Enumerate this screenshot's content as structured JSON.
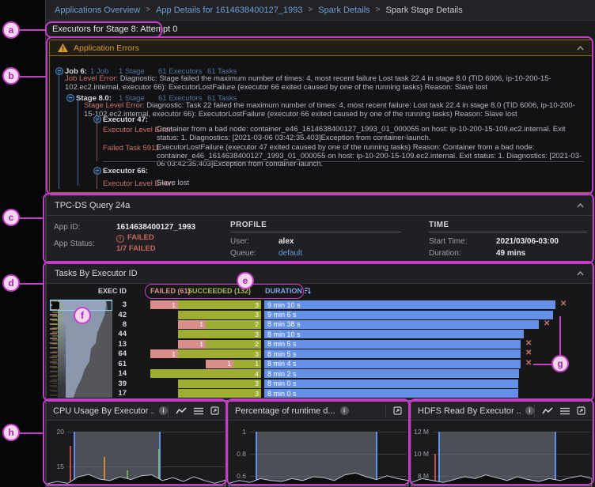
{
  "breadcrumb": {
    "separator": ">",
    "items": [
      {
        "label": "Applications Overview",
        "current": false
      },
      {
        "label": "App Details for 1614638400127_1993",
        "current": false
      },
      {
        "label": "Spark Details",
        "current": false
      },
      {
        "label": "Spark Stage Details",
        "current": true
      }
    ]
  },
  "page_title": "Executors for Stage 8: Attempt 0",
  "errors_panel": {
    "title": "Application Errors",
    "job_label": "Job 6:",
    "job_counts": [
      "1 Job",
      "1 Stage",
      "61 Executors",
      "61 Tasks"
    ],
    "job_error_label": "Job Level Error:",
    "job_error_text": "Diagnostic: Stage failed the maximum number of times: 4, most recent failure Lost task 22.4 in stage 8.0 (TID 6006, ip-10-200-15-102.ec2.internal, executor 66): ExecutorLostFailure (executor 66 exited caused by one of the running tasks) Reason: Slave lost",
    "stage_label": "Stage 8.0:",
    "stage_counts": [
      "1 Stage",
      "61 Executors",
      "61 Tasks"
    ],
    "stage_error_label": "Stage Level Error:",
    "stage_error_text": "Diagnostic: Task 22 failed the maximum number of times: 4, most recent failure: Lost task 22.4 in stage 8.0 (TID 6006, ip-10-200-15-102.ec2.internal, executor 66): ExecutorLostFailure (executor 66 exited caused by one of the running tasks) Reason: Slave lost",
    "executors": [
      {
        "label": "Executor 47:",
        "rows": [
          {
            "label": "Executor Level Error:",
            "text": "Container from a bad node: container_e46_1614638400127_1993_01_000055 on host: ip-10-200-15-109.ec2.internal. Exit status: 1. Diagnostics: [2021-03-06 03:42:35.403]Exception from container-launch."
          },
          {
            "label": "Failed Task 5911:",
            "text": "ExecutorLostFailure (executor 47 exited caused by one of the running tasks) Reason: Container from a bad node: container_e46_1614638400127_1993_01_000055 on host: ip-10-200-15-109.ec2.internal. Exit status: 1. Diagnostics: [2021-03-06 03:42:35.403]Exception from container-launch."
          }
        ]
      },
      {
        "label": "Executor 66:",
        "rows": [
          {
            "label": "Executor Level Error:",
            "text": "Slave lost"
          }
        ]
      }
    ]
  },
  "query_panel": {
    "title": "TPC-DS Query 24a",
    "app_id_label": "App ID:",
    "app_id": "1614638400127_1993",
    "app_status_label": "App Status:",
    "status_failed": "FAILED",
    "status_ratio": "1/7 FAILED",
    "profile_header": "PROFILE",
    "user_label": "User:",
    "user": "alex",
    "queue_label": "Queue:",
    "queue": "default",
    "time_header": "TIME",
    "start_label": "Start Time:",
    "start": "2021/03/06-03:00",
    "duration_label": "Duration:",
    "duration": "49 mins"
  },
  "tasks_panel": {
    "title": "Tasks By Executor ID",
    "col_exec": "EXEC ID",
    "col_failed": "FAILED (61)",
    "col_succeeded": "SUCCEEDED (132)",
    "col_duration": "DURATION",
    "rows": [
      {
        "exec_id": "3",
        "failed": 1,
        "succeeded": 3,
        "duration": "9 min 10 s",
        "duration_s": 550,
        "lost": true
      },
      {
        "exec_id": "42",
        "failed": 0,
        "succeeded": 3,
        "duration": "9 min 6 s",
        "duration_s": 546,
        "lost": false
      },
      {
        "exec_id": "8",
        "failed": 1,
        "succeeded": 2,
        "duration": "8 min 38 s",
        "duration_s": 518,
        "lost": true
      },
      {
        "exec_id": "44",
        "failed": 0,
        "succeeded": 3,
        "duration": "8 min 10 s",
        "duration_s": 490,
        "lost": false
      },
      {
        "exec_id": "13",
        "failed": 1,
        "succeeded": 2,
        "duration": "8 min 5 s",
        "duration_s": 485,
        "lost": true
      },
      {
        "exec_id": "64",
        "failed": 1,
        "succeeded": 3,
        "duration": "8 min 5 s",
        "duration_s": 485,
        "lost": true
      },
      {
        "exec_id": "61",
        "failed": 1,
        "succeeded": 1,
        "duration": "8 min 4 s",
        "duration_s": 484,
        "lost": true
      },
      {
        "exec_id": "14",
        "failed": 0,
        "succeeded": 4,
        "duration": "8 min 2 s",
        "duration_s": 482,
        "lost": false
      },
      {
        "exec_id": "39",
        "failed": 0,
        "succeeded": 3,
        "duration": "8 min 0 s",
        "duration_s": 480,
        "lost": false
      },
      {
        "exec_id": "17",
        "failed": 0,
        "succeeded": 3,
        "duration": "8 min 0 s",
        "duration_s": 480,
        "lost": false
      }
    ]
  },
  "charts": [
    {
      "title": "CPU Usage By Executor ...",
      "y_ticks": [
        "20",
        "15"
      ],
      "tick_gap": 44,
      "icons": [
        "line-chart",
        "list",
        "expand"
      ],
      "brush": [
        0.04,
        0.6
      ],
      "spikes": [
        {
          "x": 0.014,
          "h": 0.72,
          "color": "#c2504a"
        },
        {
          "x": 0.237,
          "h": 0.52,
          "color": "#cd8a3c"
        },
        {
          "x": 0.382,
          "h": 0.28,
          "color": "#79a05a"
        },
        {
          "x": 0.585,
          "h": 0.66,
          "color": "#7fae8a"
        }
      ],
      "area": [
        0.12,
        0.25,
        0.15,
        0.5,
        0.62,
        0.38,
        0.3,
        0.5,
        0.35,
        0.55,
        0.6,
        0.3,
        0.45,
        0.25,
        0.5,
        0.3,
        0.15,
        0.32
      ]
    },
    {
      "title": "Percentage of runtime d...",
      "y_ticks": [
        "1",
        "0.8",
        "0.6"
      ],
      "tick_gap": 28,
      "icons": [
        "expand"
      ],
      "brush": [
        0.04,
        0.82
      ],
      "spikes": [],
      "area": [
        0.15,
        0.3,
        0.2,
        0.4,
        0.3,
        0.25,
        0.4,
        0.3,
        0.5,
        0.45,
        0.3,
        0.6,
        0.7,
        0.5,
        0.35,
        0.55,
        0.4,
        0.3
      ]
    },
    {
      "title": "HDFS Read By Executor ...",
      "y_ticks": [
        "12 M",
        "10 M",
        "8 M"
      ],
      "tick_gap": 28,
      "icons": [
        "line-chart",
        "list",
        "expand"
      ],
      "brush": [
        0.04,
        0.79
      ],
      "spikes": [
        {
          "x": 0.015,
          "h": 0.58,
          "color": "#c2504a"
        }
      ],
      "area": [
        0.2,
        0.4,
        0.3,
        0.2,
        0.35,
        0.5,
        0.4,
        0.6,
        0.45,
        0.3,
        0.5,
        0.35,
        0.25,
        0.4,
        0.3,
        0.45,
        0.55,
        0.4
      ]
    }
  ],
  "annotations": {
    "a": "a",
    "b": "b",
    "c": "c",
    "d": "d",
    "e": "e",
    "f": "f",
    "g": "g",
    "h": "h"
  },
  "colors": {
    "annotation_pink": "#c43ec8",
    "failed_bar": "#d88f8c",
    "succeeded_bar": "#9fae33",
    "duration_bar": "#6590e8",
    "error_amber": "#d89b2e",
    "error_red": "#cf7168",
    "status_red": "#c9655d",
    "link_blue": "#6b9fd4",
    "brush_blue": "#5f8fe8"
  }
}
